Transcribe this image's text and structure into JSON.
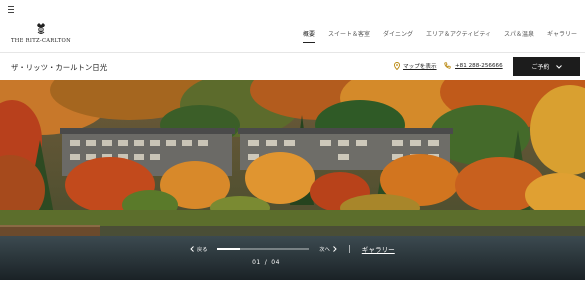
{
  "header": {
    "logo_text": "THE RITZ-CARLTON",
    "nav": [
      {
        "label": "概要",
        "active": true
      },
      {
        "label": "スイート＆客室",
        "active": false
      },
      {
        "label": "ダイニング",
        "active": false
      },
      {
        "label": "エリア＆アクティビティ",
        "active": false
      },
      {
        "label": "スパ＆温泉",
        "active": false
      },
      {
        "label": "ギャラリー",
        "active": false
      }
    ]
  },
  "subheader": {
    "hotel_name": "ザ・リッツ・カールトン日光",
    "map_label": "マップを表示",
    "phone": "+81 288-256666",
    "reserve_label": "ご予約"
  },
  "hero": {
    "image_alt": "lakeside hotel surrounded by autumn foliage",
    "carousel": {
      "prev_label": "戻る",
      "next_label": "次へ",
      "progress": 0.25,
      "current": "01",
      "total": "04",
      "separator": "/",
      "gallery_label": "ギャラリー"
    }
  },
  "icons": {
    "menu": "hamburger-icon",
    "map": "map-pin-icon",
    "phone": "phone-icon",
    "reserve": "chevron-down-icon"
  }
}
